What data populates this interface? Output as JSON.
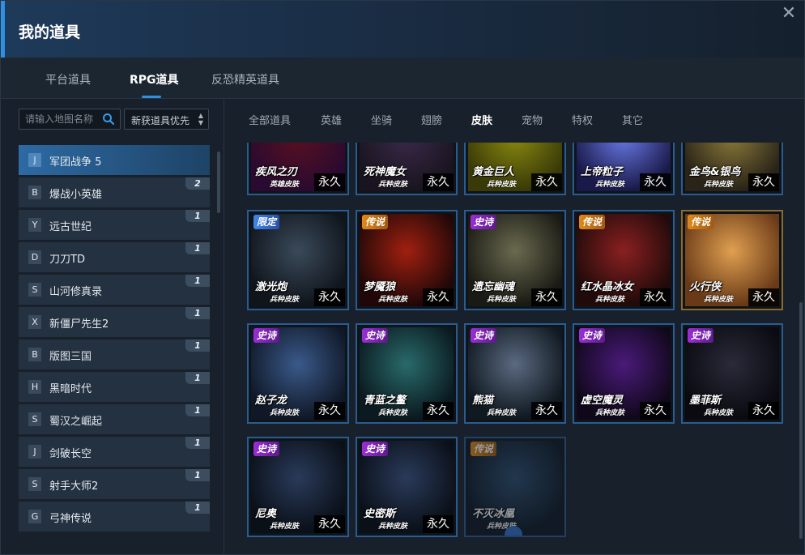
{
  "window": {
    "title": "我的道具",
    "close_label": "✕"
  },
  "top_tabs": [
    {
      "label": "平台道具"
    },
    {
      "label": "RPG道具"
    },
    {
      "label": "反恐精英道具"
    }
  ],
  "left": {
    "search_placeholder": "请输入地图名称",
    "sort_label": "新获道具优先",
    "maps": [
      {
        "letter": "J",
        "name": "军团战争 5",
        "badge": ""
      },
      {
        "letter": "B",
        "name": "爆战小英雄",
        "badge": "2"
      },
      {
        "letter": "Y",
        "name": "远古世纪",
        "badge": "1"
      },
      {
        "letter": "D",
        "name": "刀刀TD",
        "badge": "1"
      },
      {
        "letter": "S",
        "name": "山河修真录",
        "badge": "1"
      },
      {
        "letter": "X",
        "name": "新僵尸先生2",
        "badge": "1"
      },
      {
        "letter": "B",
        "name": "版图三国",
        "badge": "1"
      },
      {
        "letter": "H",
        "name": "黑暗时代",
        "badge": "1"
      },
      {
        "letter": "S",
        "name": "蜀汉之崛起",
        "badge": "1"
      },
      {
        "letter": "J",
        "name": "剑破长空",
        "badge": "1"
      },
      {
        "letter": "S",
        "name": "射手大师2",
        "badge": "1"
      },
      {
        "letter": "G",
        "name": "弓神传说",
        "badge": "1"
      }
    ]
  },
  "category_tabs": [
    {
      "label": "全部道具"
    },
    {
      "label": "英雄"
    },
    {
      "label": "坐骑"
    },
    {
      "label": "翅膀"
    },
    {
      "label": "皮肤"
    },
    {
      "label": "宠物"
    },
    {
      "label": "特权"
    },
    {
      "label": "其它"
    }
  ],
  "items_row1": [
    {
      "name": "疾风之刃",
      "sub": "英雄皮肤",
      "duration": "永久",
      "colors": [
        "#5a1020",
        "#2a0a30"
      ]
    },
    {
      "name": "死神魔女",
      "sub": "兵种皮肤",
      "duration": "永久",
      "colors": [
        "#3a2a4a",
        "#1a1420"
      ]
    },
    {
      "name": "黄金巨人",
      "sub": "兵种皮肤",
      "duration": "永久",
      "colors": [
        "#8a8a10",
        "#3a3a08"
      ]
    },
    {
      "name": "上帝粒子",
      "sub": "兵种皮肤",
      "duration": "永久",
      "colors": [
        "#6a7ae8",
        "#1a1a4a"
      ]
    },
    {
      "name": "金鸟&银鸟",
      "sub": "兵种皮肤",
      "duration": "永久",
      "colors": [
        "#8a7a3a",
        "#2a2418"
      ]
    }
  ],
  "items_row2": [
    {
      "name": "激光炮",
      "sub": "兵种皮肤",
      "duration": "永久",
      "tag": "限定",
      "tag_style": "blue",
      "colors": [
        "#3a4a5a",
        "#10151c"
      ]
    },
    {
      "name": "梦魇狼",
      "sub": "兵种皮肤",
      "duration": "永久",
      "tag": "传说",
      "tag_style": "orange",
      "colors": [
        "#a02010",
        "#200808"
      ]
    },
    {
      "name": "遗忘幽魂",
      "sub": "兵种皮肤",
      "duration": "永久",
      "tag": "史诗",
      "tag_style": "purple",
      "colors": [
        "#6a6a50",
        "#1a1a14"
      ]
    },
    {
      "name": "红水晶冰女",
      "sub": "兵种皮肤",
      "duration": "永久",
      "tag": "传说",
      "tag_style": "orange",
      "colors": [
        "#8a2020",
        "#200a0a"
      ]
    },
    {
      "name": "火行侠",
      "sub": "兵种皮肤",
      "duration": "永久",
      "tag": "传说",
      "tag_style": "orange",
      "colors": [
        "#e0a050",
        "#6a3a18"
      ]
    }
  ],
  "items_row3": [
    {
      "name": "赵子龙",
      "sub": "兵种皮肤",
      "duration": "永久",
      "tag": "史诗",
      "tag_style": "purple",
      "colors": [
        "#3a5a8a",
        "#101828"
      ]
    },
    {
      "name": "青蓝之鳌",
      "sub": "兵种皮肤",
      "duration": "永久",
      "tag": "史诗",
      "tag_style": "purple",
      "colors": [
        "#2a6a6a",
        "#0a1a20"
      ]
    },
    {
      "name": "熊猫",
      "sub": "兵种皮肤",
      "duration": "永久",
      "tag": "史诗",
      "tag_style": "purple",
      "colors": [
        "#5a6a80",
        "#101820"
      ]
    },
    {
      "name": "虚空魔灵",
      "sub": "兵种皮肤",
      "duration": "永久",
      "tag": "史诗",
      "tag_style": "purple",
      "colors": [
        "#4a1a7a",
        "#10081a"
      ]
    },
    {
      "name": "墨菲斯",
      "sub": "兵种皮肤",
      "duration": "永久",
      "tag": "史诗",
      "tag_style": "purple",
      "colors": [
        "#2a2a3a",
        "#0a0a10"
      ]
    }
  ],
  "items_row4": [
    {
      "name": "尼奥",
      "sub": "兵种皮肤",
      "duration": "永久",
      "tag": "史诗",
      "tag_style": "purple",
      "colors": [
        "#2a3a5a",
        "#0a1018"
      ]
    },
    {
      "name": "史密斯",
      "sub": "兵种皮肤",
      "duration": "永久",
      "tag": "史诗",
      "tag_style": "purple",
      "colors": [
        "#2a3a5a",
        "#0a1018"
      ]
    },
    {
      "name": "不灭冰凰",
      "sub": "兵种皮肤",
      "duration": "",
      "tag": "传说",
      "tag_style": "orange",
      "colors": [
        "#2a4a6a",
        "#0a1420"
      ]
    }
  ],
  "colors": {
    "accent": "#2f8fe0",
    "card_border": "#2b5c8f",
    "card_border_gold": "#8c6a2c"
  }
}
